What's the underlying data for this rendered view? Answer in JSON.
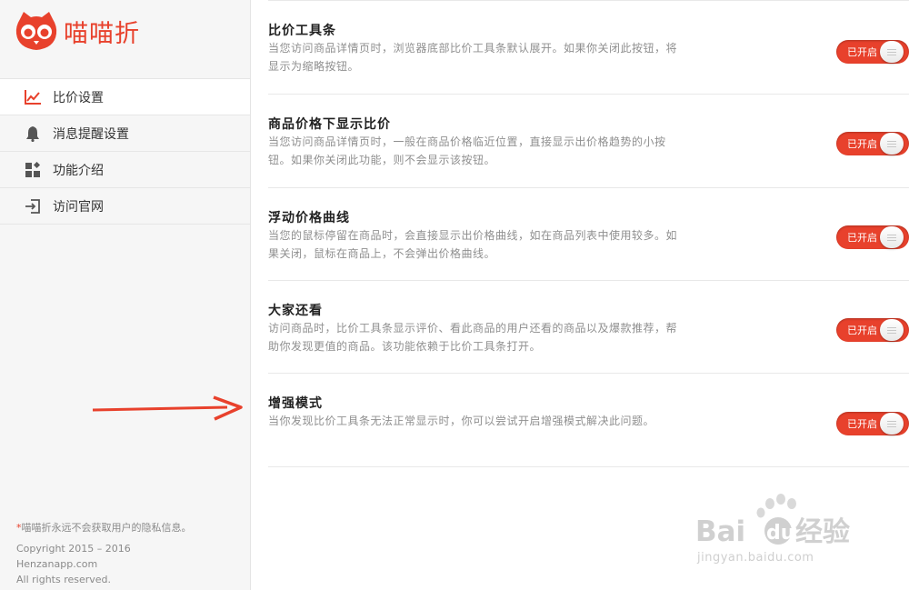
{
  "app": {
    "name": "喵喵折"
  },
  "sidebar": {
    "items": [
      {
        "label": "比价设置",
        "icon": "chart-line-icon",
        "active": true
      },
      {
        "label": "消息提醒设置",
        "icon": "bell-icon",
        "active": false
      },
      {
        "label": "功能介绍",
        "icon": "feature-blocks-icon",
        "active": false
      },
      {
        "label": "访问官网",
        "icon": "enter-icon",
        "active": false
      }
    ],
    "footer": {
      "privacy_mark": "*",
      "privacy": "喵喵折永远不会获取用户的隐私信息。",
      "copyright": "Copyright 2015 – 2016",
      "site": "Henzanapp.com",
      "rights": "All rights reserved."
    }
  },
  "settings": [
    {
      "title": "比价工具条",
      "desc": "当您访问商品详情页时，浏览器底部比价工具条默认展开。如果你关闭此按钮，将显示为缩略按钮。",
      "toggle": "已开启"
    },
    {
      "title": "商品价格下显示比价",
      "desc": "当您访问商品详情页时，一般在商品价格临近位置，直接显示出价格趋势的小按钮。如果你关闭此功能，则不会显示该按钮。",
      "toggle": "已开启"
    },
    {
      "title": "浮动价格曲线",
      "desc": "当您的鼠标停留在商品时，会直接显示出价格曲线，如在商品列表中使用较多。如果关闭，鼠标在商品上，不会弹出价格曲线。",
      "toggle": "已开启"
    },
    {
      "title": "大家还看",
      "desc": "访问商品时，比价工具条显示评价、看此商品的用户还看的商品以及爆款推荐，帮助你发现更值的商品。该功能依赖于比价工具条打开。",
      "toggle": "已开启"
    },
    {
      "title": "增强模式",
      "desc": "当你发现比价工具条无法正常显示时，你可以尝试开启增强模式解决此问题。",
      "toggle": "已开启"
    }
  ],
  "watermark": {
    "brand": "Bai",
    "brand2": "du",
    "brand_cn": "经验",
    "url": "jingyan.baidu.com"
  },
  "colors": {
    "accent": "#e8412c",
    "sidebar_bg": "#f6f6f6",
    "desc_text": "#8f8f8f"
  }
}
